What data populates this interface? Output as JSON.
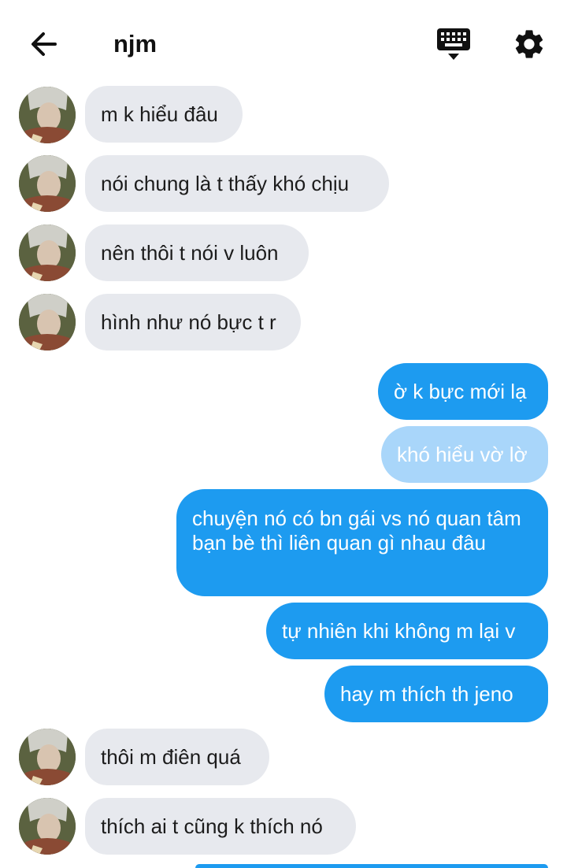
{
  "header": {
    "title": "njm",
    "back_icon": "arrow-left-icon",
    "keyboard_icon": "keyboard-icon",
    "settings_icon": "gear-icon"
  },
  "colors": {
    "outgoing_bubble": "#1d9bf0",
    "outgoing_pending": "#a9d6fa",
    "incoming_bubble": "#e7e9ee"
  },
  "messages": [
    {
      "dir": "in",
      "text": "m k hiểu đâu"
    },
    {
      "dir": "in",
      "text": "nói chung là t thấy khó chịu"
    },
    {
      "dir": "in",
      "text": "nên thôi t nói v luôn"
    },
    {
      "dir": "in",
      "text": "hình như nó bực t r"
    },
    {
      "dir": "out",
      "text": "ờ k bực mới lạ"
    },
    {
      "dir": "out",
      "text": "khó hiểu vờ lờ",
      "status": "pending"
    },
    {
      "dir": "out",
      "text": "chuyện nó có bn gái vs nó quan tâm bạn bè thì liên quan gì nhau đâu"
    },
    {
      "dir": "out",
      "text": "tự nhiên khi không m lại v"
    },
    {
      "dir": "out",
      "text": "hay m thích th jeno"
    },
    {
      "dir": "in",
      "text": "thôi m điên quá"
    },
    {
      "dir": "in",
      "text": "thích ai t cũng k thích nó"
    }
  ]
}
